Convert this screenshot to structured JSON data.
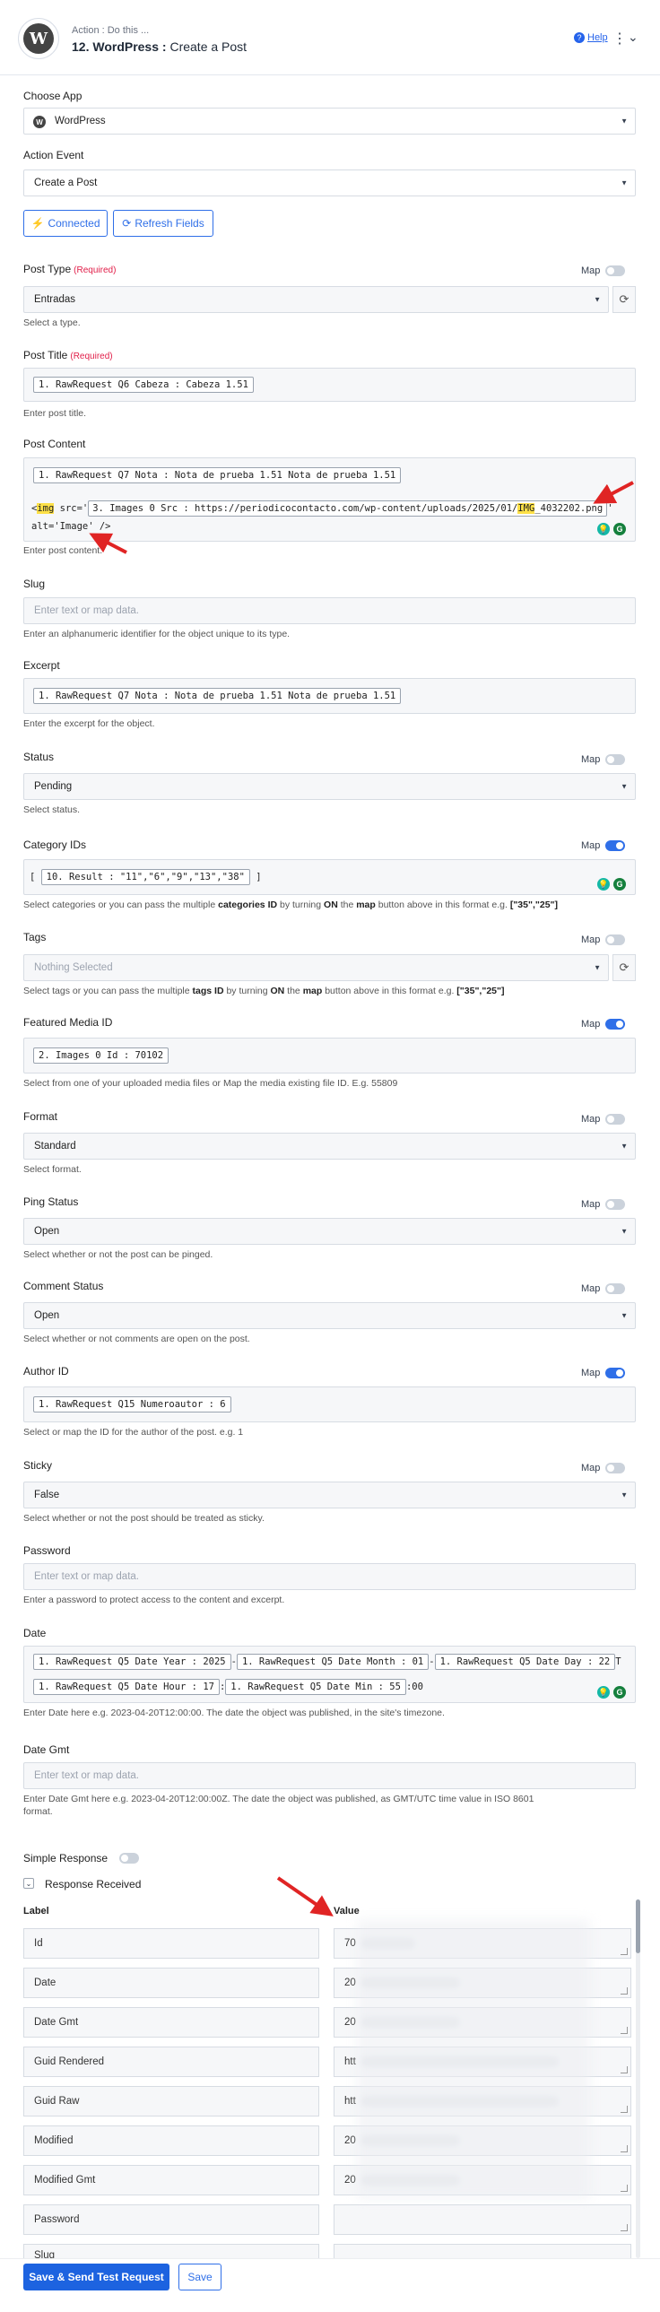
{
  "header": {
    "subtitle": "Action : Do this ...",
    "step_title": "12. WordPress :",
    "step_action": "Create a Post",
    "help": "Help",
    "logo_letter": "W"
  },
  "choose_app": {
    "label": "Choose App",
    "value": "WordPress"
  },
  "action_event": {
    "label": "Action Event",
    "value": "Create a Post"
  },
  "buttons": {
    "connected": "Connected",
    "refresh": "Refresh Fields",
    "save_send": "Save & Send Test Request",
    "save": "Save"
  },
  "map_label": "Map",
  "required": "(Required)",
  "post_type": {
    "label": "Post Type",
    "value": "Entradas",
    "hint": "Select a type."
  },
  "post_title": {
    "label": "Post Title",
    "chip": "1. RawRequest Q6 Cabeza : Cabeza 1.51",
    "hint": "Enter post title."
  },
  "post_content": {
    "label": "Post Content",
    "chip1": "1. RawRequest Q7 Nota : Nota de prueba 1.51 Nota de prueba 1.51",
    "pre": "<",
    "img_tag": "img",
    "src": " src='",
    "chip2_pre": "3. Images 0 Src : https://periodicocontacto.com/wp-content/uploads/2025/01/",
    "chip2_hl": "IMG",
    "chip2_post": "_4032202.png",
    "after_chip": "'",
    "line2": "alt='Image' />",
    "hint": "Enter post content."
  },
  "slug": {
    "label": "Slug",
    "placeholder": "Enter text or map data.",
    "hint": "Enter an alphanumeric identifier for the object unique to its type."
  },
  "excerpt": {
    "label": "Excerpt",
    "chip": "1. RawRequest Q7 Nota : Nota de prueba 1.51 Nota de prueba 1.51",
    "hint": "Enter the excerpt for the object."
  },
  "status": {
    "label": "Status",
    "value": "Pending",
    "hint": "Select status."
  },
  "category_ids": {
    "label": "Category IDs",
    "open": "[",
    "chip": "10. Result : \"11\",\"6\",\"9\",\"13\",\"38\"",
    "close": "]",
    "hint_a": "Select categories or you can pass the multiple ",
    "hint_b": "categories ID",
    "hint_c": " by turning ",
    "hint_d": "ON",
    "hint_e": " the ",
    "hint_f": "map",
    "hint_g": " button above in this format e.g. ",
    "hint_h": "[\"35\",\"25\"]"
  },
  "tags": {
    "label": "Tags",
    "value": "Nothing Selected",
    "hint_a": "Select tags or you can pass the multiple ",
    "hint_b": "tags ID",
    "hint_c": " by turning ",
    "hint_d": "ON",
    "hint_e": " the ",
    "hint_f": "map",
    "hint_g": " button above in this format e.g. ",
    "hint_h": "[\"35\",\"25\"]"
  },
  "featured_media": {
    "label": "Featured Media ID",
    "chip": "2. Images 0 Id : 70102",
    "hint": "Select from one of your uploaded media files or Map the media existing file ID. E.g. 55809"
  },
  "format": {
    "label": "Format",
    "value": "Standard",
    "hint": "Select format."
  },
  "ping_status": {
    "label": "Ping Status",
    "value": "Open",
    "hint": "Select whether or not the post can be pinged."
  },
  "comment_status": {
    "label": "Comment Status",
    "value": "Open",
    "hint": "Select whether or not comments are open on the post."
  },
  "author_id": {
    "label": "Author ID",
    "chip": "1. RawRequest Q15 Numeroautor : 6",
    "hint": "Select or map the ID for the author of the post. e.g. 1"
  },
  "sticky": {
    "label": "Sticky",
    "value": "False",
    "hint": "Select whether or not the post should be treated as sticky."
  },
  "password": {
    "label": "Password",
    "placeholder": "Enter text or map data.",
    "hint": "Enter a password to protect access to the content and excerpt."
  },
  "date": {
    "label": "Date",
    "c1": "1. RawRequest Q5 Date Year : 2025",
    "s1": "-",
    "c2": "1. RawRequest Q5 Date Month : 01",
    "s2": "-",
    "c3": "1. RawRequest Q5 Date Day : 22",
    "s3": "T",
    "c4": "1. RawRequest Q5 Date Hour : 17",
    "s4": ":",
    "c5": "1. RawRequest Q5 Date Min : 55",
    "s5": ":00",
    "hint": "Enter Date here e.g. 2023-04-20T12:00:00. The date the object was published, in the site's timezone."
  },
  "date_gmt": {
    "label": "Date Gmt",
    "placeholder": "Enter text or map data.",
    "hint1": "Enter Date Gmt here e.g. 2023-04-20T12:00:00Z. The date the object was published, as GMT/UTC time value in ISO 8601",
    "hint2": "format."
  },
  "simple_response": "Simple Response",
  "response_received": "Response Received",
  "resp_headers": {
    "label": "Label",
    "value": "Value"
  },
  "response_rows": [
    {
      "label": "Id",
      "value": "70"
    },
    {
      "label": "Date",
      "value": "20"
    },
    {
      "label": "Date Gmt",
      "value": "20"
    },
    {
      "label": "Guid Rendered",
      "value": "htt"
    },
    {
      "label": "Guid Raw",
      "value": "htt"
    },
    {
      "label": "Modified",
      "value": "20"
    },
    {
      "label": "Modified Gmt",
      "value": "20"
    },
    {
      "label": "Password",
      "value": ""
    },
    {
      "label": "Slug",
      "value": ""
    }
  ],
  "colors": {
    "accent": "#2f6fe8",
    "required": "#e11d48",
    "arrow": "#e02424",
    "highlight": "#fde047"
  }
}
